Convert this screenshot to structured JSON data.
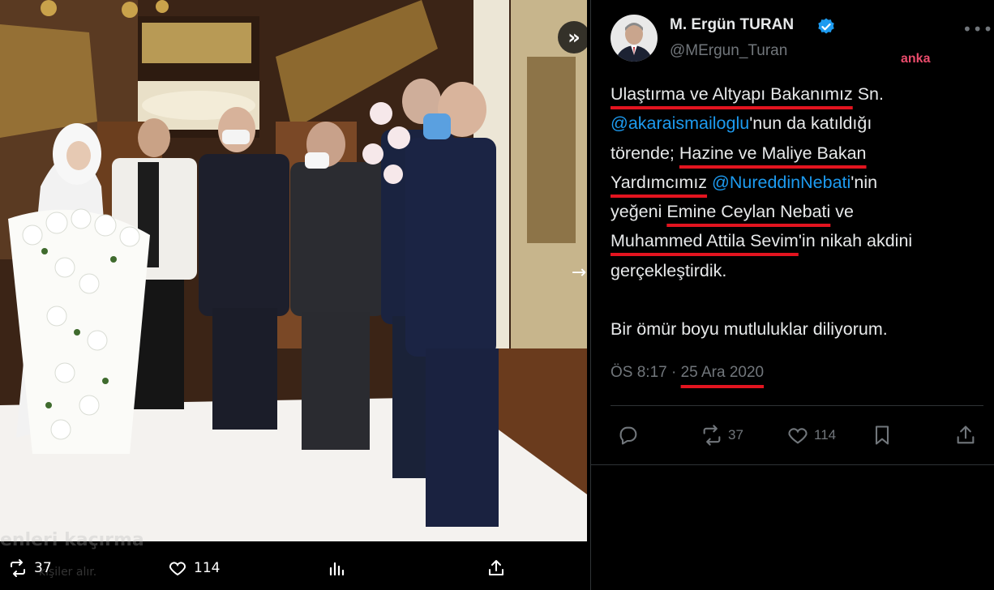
{
  "media": {
    "faded_caption": "enleri kaçırma",
    "faded_sub": "kişiler alır.",
    "retweets": "37",
    "likes": "114"
  },
  "tweet": {
    "author_name": "M. Ergün TURAN",
    "author_handle": "@MErgun_Turan",
    "watermark": "anka",
    "lines": {
      "l1a": "Ulaştırma ve Altyapı Bakanımız",
      "l1b": " Sn.",
      "l2a": "@akaraismailoglu",
      "l2b": "'nun da katıldığı",
      "l3a": "törende; ",
      "l3b": "Hazine ve Maliye Bakan",
      "l4a": "Yardımcımız",
      "l4b": " ",
      "l4c": "@NureddinNebati",
      "l4d": "'nin",
      "l5a": "yeğeni ",
      "l5b": "Emine Ceylan Nebati",
      "l5c": " ve",
      "l6a": "Muhammed Attila Sevim",
      "l6b": "'in nikah akdini",
      "l7": "gerçekleştirdik.",
      "l8": "Bir ömür boyu mutluluklar diliyorum."
    },
    "time": "ÖS 8:17",
    "separator": " · ",
    "date": "25 Ara 2020",
    "retweets": "37",
    "likes": "114"
  },
  "colors": {
    "accent": "#1d9bf0",
    "underline": "#e3141f",
    "muted": "#71767b",
    "background": "#000000"
  },
  "icons": [
    "expand-icon",
    "next-arrow-icon",
    "verified-icon",
    "more-icon",
    "reply-icon",
    "retweet-icon",
    "like-icon",
    "views-icon",
    "bookmark-icon",
    "share-icon"
  ]
}
